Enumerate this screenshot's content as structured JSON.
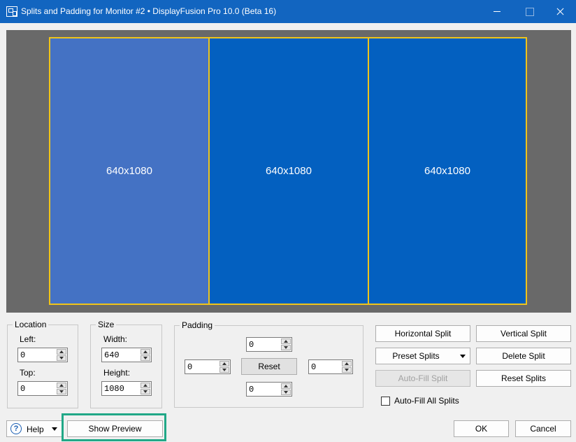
{
  "window": {
    "title": "Splits and Padding for Monitor #2 • DisplayFusion Pro 10.0 (Beta 16)"
  },
  "preview": {
    "splits": [
      {
        "label": "640x1080",
        "selected": true
      },
      {
        "label": "640x1080",
        "selected": false
      },
      {
        "label": "640x1080",
        "selected": false
      }
    ]
  },
  "location": {
    "title": "Location",
    "left_label": "Left:",
    "left_value": "0",
    "top_label": "Top:",
    "top_value": "0"
  },
  "size": {
    "title": "Size",
    "width_label": "Width:",
    "width_value": "640",
    "height_label": "Height:",
    "height_value": "1080"
  },
  "padding": {
    "title": "Padding",
    "top_value": "0",
    "left_value": "0",
    "right_value": "0",
    "bottom_value": "0",
    "reset_label": "Reset"
  },
  "actions": {
    "horizontal_split": "Horizontal Split",
    "vertical_split": "Vertical Split",
    "preset_splits": "Preset Splits",
    "delete_split": "Delete Split",
    "auto_fill_split": "Auto-Fill Split",
    "reset_splits": "Reset Splits",
    "auto_fill_all_label": "Auto-Fill All Splits",
    "auto_fill_all_checked": false
  },
  "footer": {
    "help_label": "Help",
    "show_preview_label": "Show Preview",
    "ok_label": "OK",
    "cancel_label": "Cancel"
  },
  "colors": {
    "titlebar": "#1265c0",
    "split_selected": "#4472c4",
    "split": "#0360c0",
    "split_border": "#f0c419",
    "preview_background": "#696969",
    "highlight": "#21a887"
  }
}
